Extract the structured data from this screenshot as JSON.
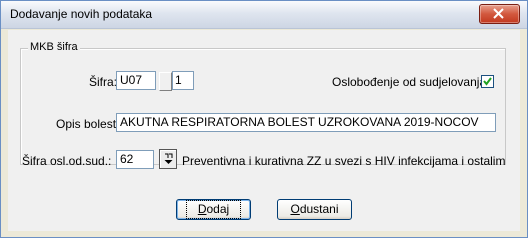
{
  "window": {
    "title": "Dodavanje novih podataka"
  },
  "group": {
    "legend": "MKB šifra"
  },
  "sifra": {
    "label": "Šifra:",
    "code": "U07",
    "sub": "1"
  },
  "oslobodjenje": {
    "label": "Oslobođenje od sudjelovanja:",
    "checked": true
  },
  "opis": {
    "label": "Opis bolesti:",
    "value": "AKUTNA RESPIRATORNA BOLEST UZROKOVANA 2019-NOCOV"
  },
  "sifra_osl": {
    "label": "Šifra osl.od.sud.:",
    "value": "62",
    "description": "Preventivna i kurativna ZZ u svezi s HIV infekcijama i ostalim"
  },
  "buttons": {
    "ok_first": "D",
    "ok_rest": "odaj",
    "cancel_first": "O",
    "cancel_rest": "dustani"
  },
  "icons": {
    "close": "close-icon",
    "checkmark": "checkmark-icon",
    "lookup": "lookup-dropdown-icon"
  }
}
